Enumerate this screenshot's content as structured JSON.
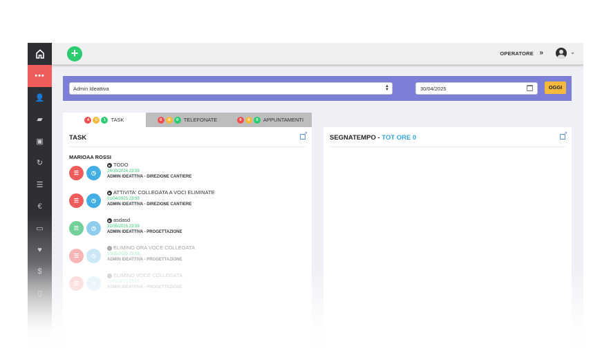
{
  "sidebar": {
    "items": [
      {
        "icon": "more-dots-icon",
        "label": "•••",
        "active": true
      },
      {
        "icon": "user-edit-icon",
        "label": "👤"
      },
      {
        "icon": "folder-icon",
        "label": "▰"
      },
      {
        "icon": "clipboard-check-icon",
        "label": "▣"
      },
      {
        "icon": "sync-icon",
        "label": "↻"
      },
      {
        "icon": "list-ordered-icon",
        "label": "☰"
      },
      {
        "icon": "euro-icon",
        "label": "€"
      },
      {
        "icon": "credit-card-icon",
        "label": "▭"
      },
      {
        "icon": "hand-heart-icon",
        "label": "♥"
      },
      {
        "icon": "hand-dollar-icon",
        "label": "$"
      },
      {
        "icon": "file-icon",
        "label": "▯"
      }
    ]
  },
  "topbar": {
    "add_label": "+",
    "operator_label": "OPERATORE",
    "operator_chevron": "»",
    "avatar_chevron": "⌄"
  },
  "filters": {
    "select_value": "Admin Ideattiva",
    "date_value": "30/04/2025",
    "today_label": "OGGI"
  },
  "tabs": [
    {
      "label": "TASK",
      "badges": [
        "4",
        "0",
        "1"
      ]
    },
    {
      "label": "TELEFONATE",
      "badges": [
        "0",
        "0",
        "0"
      ]
    },
    {
      "label": "APPUNTAMENTI",
      "badges": [
        "0",
        "0",
        "0"
      ]
    }
  ],
  "task_card": {
    "title": "TASK",
    "person": "MARIOAA ROSSI",
    "tasks": [
      {
        "title": "TODO",
        "date": "24/10/2024 23:59",
        "sub": "ADMIN IDEATTIVA - DIREZIONE CANTIERE"
      },
      {
        "title": "ATTIVITA' COLLEGATA A VOCI ELIMINATE",
        "date": "01/04/2025 23:59",
        "sub": "ADMIN IDEATTIVA - DIREZIONE CANTIERE"
      },
      {
        "title": "asdasd",
        "date": "31/05/2025 23:59",
        "sub": "ADMIN IDEATTIVA - PROGETTAZIONE"
      },
      {
        "title": "ELIMINO ORA VOCE COLLEGATA",
        "date": "10/05/2025 23:59",
        "sub": "ADMIN IDEATTIVA - PROGETTAZIONE"
      },
      {
        "title": "ELIMINO VOCE COLLEGATA",
        "date": "10/05/2025 23:59",
        "sub": "ADMIN IDEATTIVA - PROGETTAZIONE"
      }
    ]
  },
  "time_card": {
    "title": "SEGNATEMPO",
    "separator": " - ",
    "total": "TOT ORE 0"
  },
  "colors": {
    "accent_green": "#2ecc71",
    "accent_red": "#ef5c5c",
    "filter_bar": "#7b80d6",
    "accent_blue": "#2fa6d6"
  }
}
